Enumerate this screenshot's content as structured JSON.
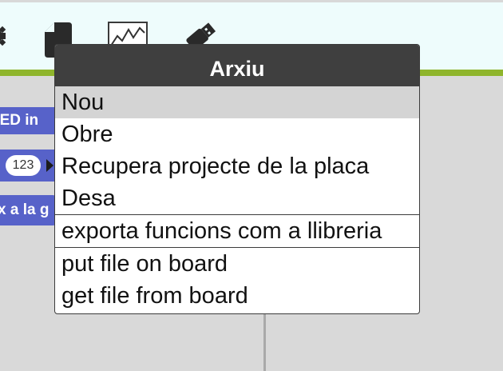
{
  "toolbar": {
    "icons": [
      "gear-icon",
      "file-icon",
      "chart-icon",
      "usb-icon"
    ]
  },
  "workspace": {
    "blocks": [
      {
        "label": "LED in"
      },
      {
        "value": "123"
      },
      {
        "label": "x a la g"
      }
    ]
  },
  "menu": {
    "title": "Arxiu",
    "group1": [
      "Nou",
      "Obre",
      "Recupera projecte de la placa",
      "Desa"
    ],
    "group2": [
      "exporta funcions com a llibreria"
    ],
    "group3": [
      "put file on board",
      "get file from board"
    ]
  },
  "colors": {
    "toolbar_bg": "#eefcfc",
    "accent_green": "#8fb52c",
    "block_blue": "#5762c9",
    "menu_header": "#3f3f3f",
    "menu_highlight": "#d4d4d4"
  }
}
